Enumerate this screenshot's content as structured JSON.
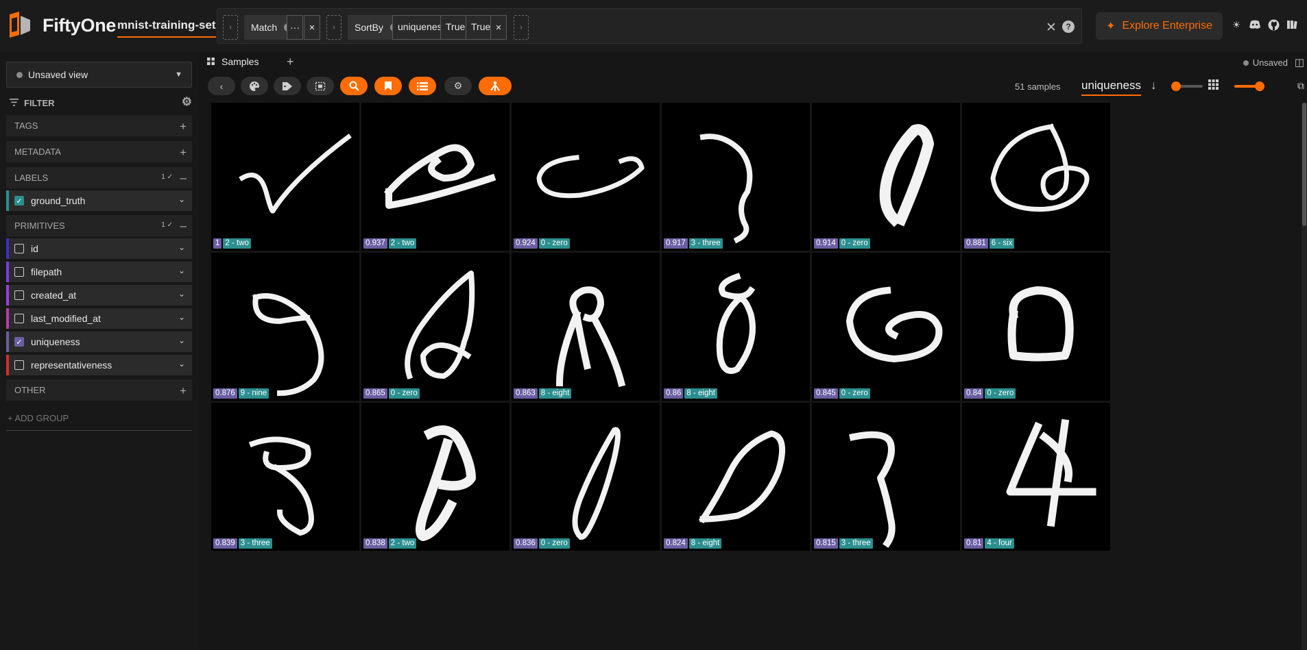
{
  "header": {
    "app_name": "FiftyOne",
    "dataset_name": "mnist-training-set",
    "view_stages": [
      {
        "label": "Match",
        "params": [
          "···"
        ]
      },
      {
        "label": "SortBy",
        "params": [
          "uniqueness",
          "True",
          "True"
        ]
      }
    ],
    "enterprise_label": "Explore Enterprise",
    "icons": [
      "sun-icon",
      "discord-icon",
      "github-icon",
      "docs-icon"
    ]
  },
  "sidebar": {
    "view_select": "Unsaved view",
    "filter_label": "FILTER",
    "groups": {
      "tags": "TAGS",
      "metadata": "METADATA",
      "labels": "LABELS",
      "labels_count": "1",
      "primitives": "PRIMITIVES",
      "primitives_count": "1",
      "other": "OTHER"
    },
    "label_fields": [
      {
        "name": "ground_truth",
        "checked": true,
        "color": "#2c8f8f"
      }
    ],
    "primitive_fields": [
      {
        "name": "id",
        "checked": false,
        "color": "#3d2fc9"
      },
      {
        "name": "filepath",
        "checked": false,
        "color": "#7a3fe0"
      },
      {
        "name": "created_at",
        "checked": false,
        "color": "#9c3fd8"
      },
      {
        "name": "last_modified_at",
        "checked": false,
        "color": "#b73ea8"
      },
      {
        "name": "uniqueness",
        "checked": true,
        "color": "#6b5fa3"
      },
      {
        "name": "representativeness",
        "checked": false,
        "color": "#d2302c"
      }
    ],
    "add_group": "+ ADD GROUP"
  },
  "main": {
    "tab_label": "Samples",
    "unsaved_label": "Unsaved",
    "sample_count": "51 samples",
    "sort_field": "uniqueness",
    "toolbar_icons": [
      "back-icon",
      "palette-icon",
      "tag-icon",
      "crop-icon",
      "search-icon",
      "bookmark-icon",
      "list-icon",
      "settings-icon",
      "merge-icon"
    ],
    "samples": [
      {
        "score": "1",
        "gt": "2 - two"
      },
      {
        "score": "0.937",
        "gt": "2 - two"
      },
      {
        "score": "0.924",
        "gt": "0 - zero"
      },
      {
        "score": "0.917",
        "gt": "3 - three"
      },
      {
        "score": "0.914",
        "gt": "0 - zero"
      },
      {
        "score": "0.881",
        "gt": "6 - six"
      },
      {
        "score": "0.876",
        "gt": "9 - nine"
      },
      {
        "score": "0.865",
        "gt": "0 - zero"
      },
      {
        "score": "0.863",
        "gt": "8 - eight"
      },
      {
        "score": "0.86",
        "gt": "8 - eight"
      },
      {
        "score": "0.845",
        "gt": "0 - zero"
      },
      {
        "score": "0.84",
        "gt": "0 - zero"
      },
      {
        "score": "0.839",
        "gt": "3 - three"
      },
      {
        "score": "0.838",
        "gt": "2 - two"
      },
      {
        "score": "0.836",
        "gt": "0 - zero"
      },
      {
        "score": "0.824",
        "gt": "8 - eight"
      },
      {
        "score": "0.815",
        "gt": "3 - three"
      },
      {
        "score": "0.81",
        "gt": "4 - four"
      }
    ]
  },
  "colors": {
    "accent": "#ff6d04",
    "score_badge": "#6b5fa3",
    "label_badge": "#2c8f8f"
  }
}
